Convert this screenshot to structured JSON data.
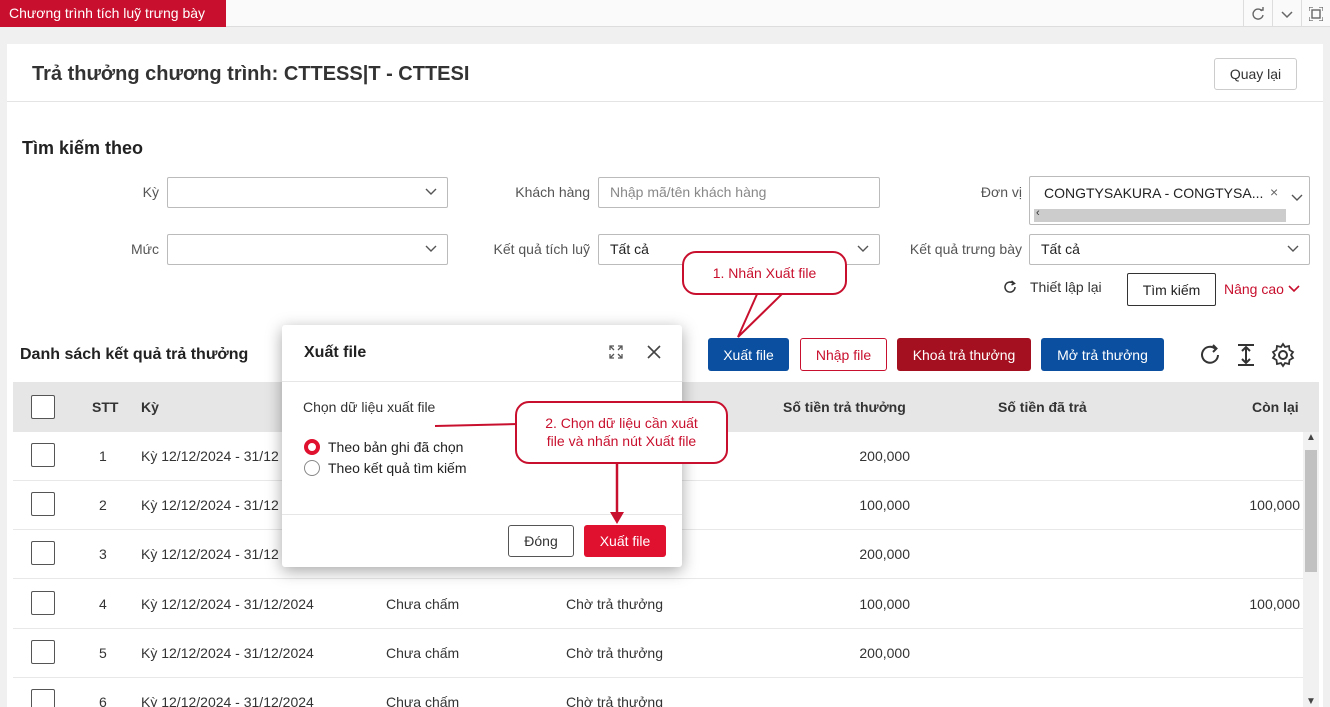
{
  "app_tab": "Chương trình tích luỹ trưng bày",
  "page": {
    "title": "Trả thưởng chương trình: CTTESS|T - CTTESI",
    "back_label": "Quay lại"
  },
  "search": {
    "title": "Tìm kiếm theo",
    "ky_label": "Kỳ",
    "ky_value": "",
    "khach_hang_label": "Khách hàng",
    "khach_hang_placeholder": "Nhập mã/tên khách hàng",
    "don_vi_label": "Đơn vị",
    "don_vi_tag": "CONGTYSAKURA - CONGTYSA...",
    "muc_label": "Mức",
    "muc_value": "",
    "ket_qua_tich_luy_label": "Kết quả tích luỹ",
    "ket_qua_tich_luy_value": "Tất cả",
    "ket_qua_trung_bay_label": "Kết quả trưng bày",
    "ket_qua_trung_bay_value": "Tất cả",
    "reset_label": "Thiết lập lại",
    "search_label": "Tìm kiếm",
    "advanced_label": "Nâng cao"
  },
  "list": {
    "title": "Danh sách kết quả trả thưởng",
    "buttons": {
      "export": "Xuất file",
      "import": "Nhập file",
      "lock": "Khoá trả thưởng",
      "unlock": "Mở trả thưởng"
    },
    "columns": {
      "stt": "STT",
      "ky": "Kỳ",
      "so_tien_tra_thuong": "Số tiền trả thưởng",
      "so_tien_da_tra": "Số tiền đã trả",
      "con_lai": "Còn lại"
    },
    "rows": [
      {
        "stt": "1",
        "ky": "Kỳ 12/12/2024 - 31/12",
        "cham": "",
        "trang_thai": "",
        "so_tien": "200,000",
        "da_tra": "",
        "con_lai": ""
      },
      {
        "stt": "2",
        "ky": "Kỳ 12/12/2024 - 31/12",
        "cham": "",
        "trang_thai": "",
        "so_tien": "100,000",
        "da_tra": "",
        "con_lai": "100,000"
      },
      {
        "stt": "3",
        "ky": "Kỳ 12/12/2024 - 31/12",
        "cham": "",
        "trang_thai": "",
        "so_tien": "200,000",
        "da_tra": "",
        "con_lai": ""
      },
      {
        "stt": "4",
        "ky": "Kỳ 12/12/2024 - 31/12/2024",
        "cham": "Chưa chấm",
        "trang_thai": "Chờ trả thưởng",
        "so_tien": "100,000",
        "da_tra": "",
        "con_lai": "100,000"
      },
      {
        "stt": "5",
        "ky": "Kỳ 12/12/2024 - 31/12/2024",
        "cham": "Chưa chấm",
        "trang_thai": "Chờ trả thưởng",
        "so_tien": "200,000",
        "da_tra": "",
        "con_lai": ""
      },
      {
        "stt": "6",
        "ky": "Kỳ 12/12/2024 - 31/12/2024",
        "cham": "Chưa chấm",
        "trang_thai": "Chờ trả thưởng",
        "so_tien": "",
        "da_tra": "",
        "con_lai": ""
      }
    ]
  },
  "modal": {
    "title": "Xuất file",
    "prompt": "Chọn dữ liệu xuất file",
    "options": [
      "Theo bản ghi đã chọn",
      "Theo kết quả tìm kiếm"
    ],
    "selected": "Theo bản ghi đã chọn",
    "close_label": "Đóng",
    "export_label": "Xuất file"
  },
  "callouts": {
    "step1": "1. Nhấn Xuất file",
    "step2_line1": "2. Chọn dữ liệu cần xuất",
    "step2_line2": "file và nhấn nút Xuất file"
  },
  "colors": {
    "brand_red": "#c8102e",
    "primary_blue": "#0a4fa0",
    "dark_red": "#a4101f",
    "modal_red": "#e0102f"
  }
}
